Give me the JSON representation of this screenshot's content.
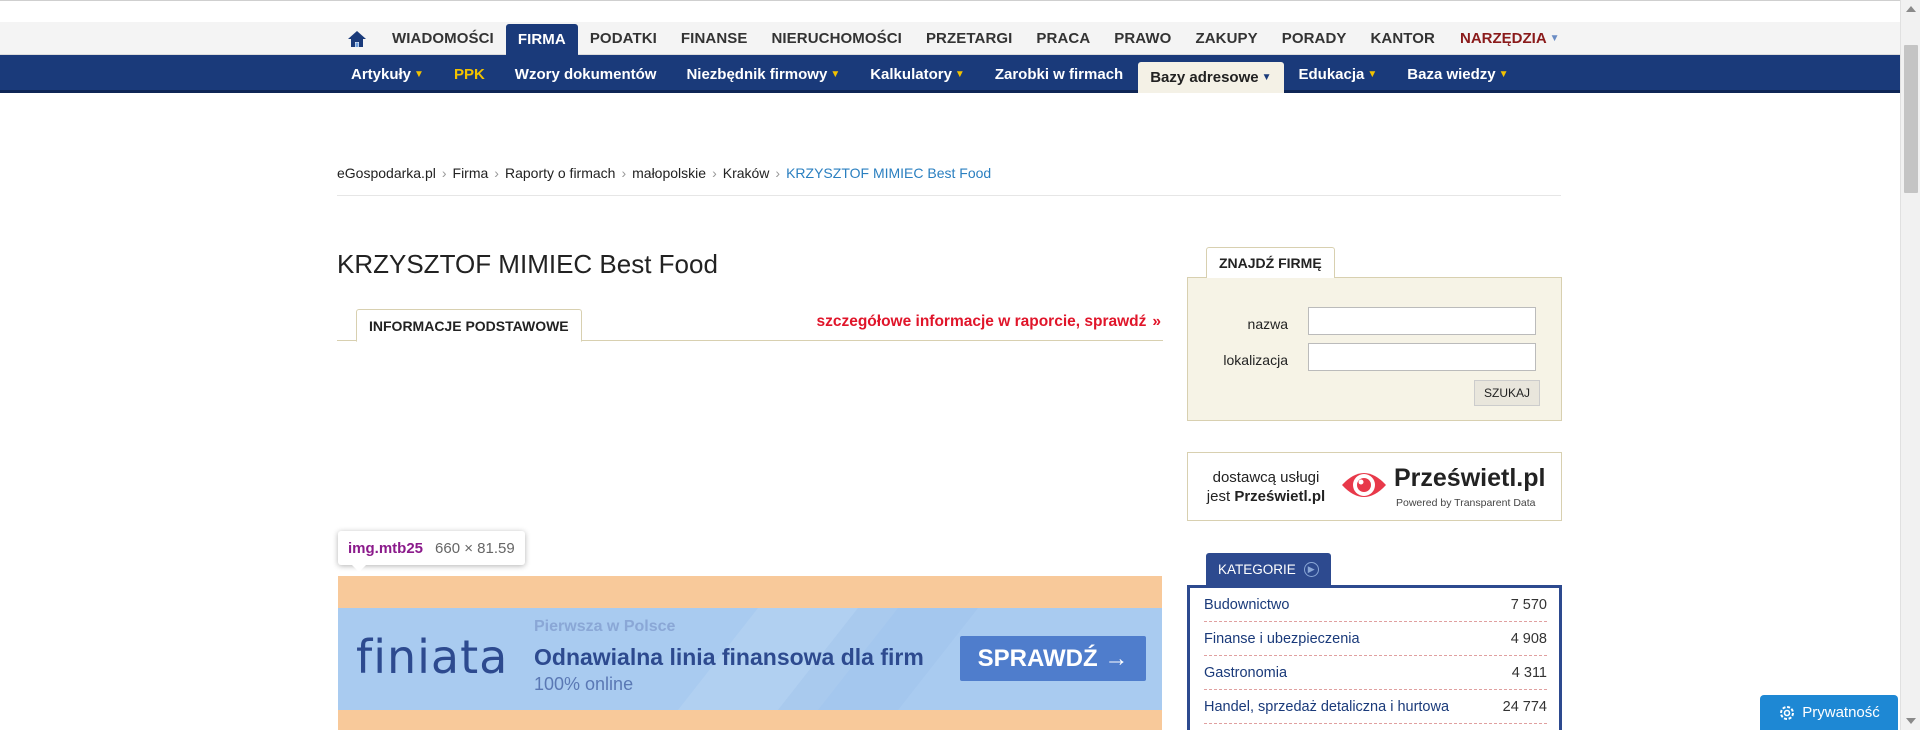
{
  "top_nav": {
    "items": [
      {
        "label": "WIADOMOŚCI",
        "active": false
      },
      {
        "label": "FIRMA",
        "active": true
      },
      {
        "label": "PODATKI",
        "active": false
      },
      {
        "label": "FINANSE",
        "active": false
      },
      {
        "label": "NIERUCHOMOŚCI",
        "active": false
      },
      {
        "label": "PRZETARGI",
        "active": false
      },
      {
        "label": "PRACA",
        "active": false
      },
      {
        "label": "PRAWO",
        "active": false
      },
      {
        "label": "ZAKUPY",
        "active": false
      },
      {
        "label": "PORADY",
        "active": false
      },
      {
        "label": "KANTOR",
        "active": false
      }
    ],
    "tools_label": "NARZĘDZIA",
    "home_icon": "home-icon"
  },
  "sub_nav": {
    "items": [
      {
        "label": "Artykuły"
      },
      {
        "label": "PPK"
      },
      {
        "label": "Wzory dokumentów"
      },
      {
        "label": "Niezbędnik firmowy"
      },
      {
        "label": "Kalkulatory"
      },
      {
        "label": "Zarobki w firmach"
      },
      {
        "label": "Bazy adresowe"
      },
      {
        "label": "Edukacja"
      },
      {
        "label": "Baza wiedzy"
      }
    ]
  },
  "breadcrumb": {
    "items": [
      "eGospodarka.pl",
      "Firma",
      "Raporty o firmach",
      "małopolskie",
      "Kraków"
    ],
    "current": "KRZYSZTOF MIMIEC Best Food"
  },
  "page": {
    "title": "KRZYSZTOF MIMIEC Best Food",
    "tab_label": "INFORMACJE PODSTAWOWE",
    "report_link": "szczegółowe informacje w raporcie, sprawdź",
    "report_link_arrow": "»"
  },
  "tooltip": {
    "tag": "img.mtb25",
    "dims": "660 × 81.59"
  },
  "banner": {
    "logo": "finiata",
    "small": "Pierwsza w Polsce",
    "headline": "Odnawialna linia finansowa dla firm",
    "sub": "100% online",
    "button": "SPRAWDŹ →"
  },
  "search": {
    "tab_label": "ZNAJDŹ FIRMĘ",
    "name_label": "nazwa",
    "location_label": "lokalizacja",
    "name_value": "",
    "location_value": "",
    "button": "SZUKAJ"
  },
  "provider": {
    "line1": "dostawcą usługi",
    "line2_prefix": "jest",
    "line2_brand": "Prześwietl.pl",
    "brand": "Prześwietl.pl",
    "powered": "Powered by Transparent Data"
  },
  "categories": {
    "tab_label": "KATEGORIE",
    "items": [
      {
        "name": "Budownictwo",
        "count": "7 570"
      },
      {
        "name": "Finanse i ubezpieczenia",
        "count": "4 908"
      },
      {
        "name": "Gastronomia",
        "count": "4 311"
      },
      {
        "name": "Handel, sprzedaż detaliczna i hurtowa",
        "count": "24 774"
      }
    ]
  },
  "privacy": {
    "label": "Prywatność"
  },
  "colors": {
    "nav_blue": "#1a3a7a",
    "accent_red": "#e0152a",
    "tools_red": "#8a1a1a",
    "link_blue": "#2a7fc0",
    "beige": "#f6f3e6"
  }
}
